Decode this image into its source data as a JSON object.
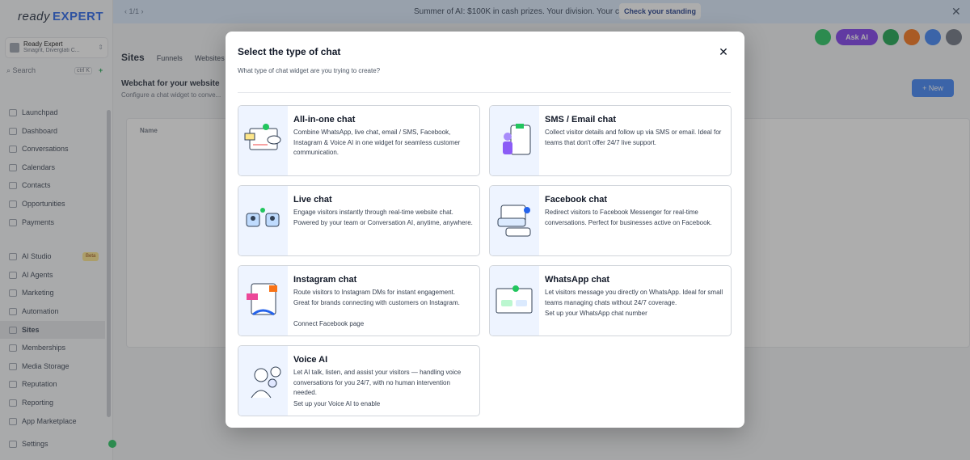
{
  "app": {
    "logo_ready": "ready",
    "logo_expert": "EXPERT",
    "account_name": "Ready Expert",
    "account_sub": "Sinagrit, Diverglati C...",
    "search_label": "Search",
    "search_shortcut": "ctrl K"
  },
  "sidebar": {
    "items": [
      {
        "label": "Launchpad",
        "icon": "rocket-icon"
      },
      {
        "label": "Dashboard",
        "icon": "dashboard-icon"
      },
      {
        "label": "Conversations",
        "icon": "chat-icon"
      },
      {
        "label": "Calendars",
        "icon": "calendar-icon"
      },
      {
        "label": "Contacts",
        "icon": "contacts-icon"
      },
      {
        "label": "Opportunities",
        "icon": "funnel-icon"
      },
      {
        "label": "Payments",
        "icon": "payments-icon"
      }
    ],
    "items2": [
      {
        "label": "AI Studio",
        "icon": "ai-studio-icon",
        "badge": "Beta"
      },
      {
        "label": "AI Agents",
        "icon": "ai-agents-icon"
      },
      {
        "label": "Marketing",
        "icon": "send-icon"
      },
      {
        "label": "Automation",
        "icon": "automation-icon"
      },
      {
        "label": "Sites",
        "icon": "sites-icon",
        "active": true
      },
      {
        "label": "Memberships",
        "icon": "memberships-icon"
      },
      {
        "label": "Media Storage",
        "icon": "media-icon"
      },
      {
        "label": "Reputation",
        "icon": "star-icon"
      },
      {
        "label": "Reporting",
        "icon": "reporting-icon"
      },
      {
        "label": "App Marketplace",
        "icon": "marketplace-icon"
      }
    ],
    "settings_label": "Settings"
  },
  "banner": {
    "pager": "1/1",
    "message": "Summer of AI: $100K in cash prizes. Your division. Your clients.",
    "cta": "Check your standing"
  },
  "header": {
    "ask_ai": "Ask AI",
    "colors": {
      "phone": "#22c55e",
      "ask_ai": "#7c3aed",
      "announce": "#16a34a",
      "bell": "#f97316",
      "help": "#3b82f6",
      "avatar": "#6b7280"
    }
  },
  "subnav": {
    "title": "Sites",
    "tabs": [
      "Funnels",
      "Websites"
    ]
  },
  "page": {
    "title": "Webchat for your website",
    "subtitle": "Configure a chat widget to conve...",
    "new_button": "+ New",
    "column_name": "Name"
  },
  "modal": {
    "title": "Select the type of chat",
    "subtitle": "What type of chat widget are you trying to create?",
    "close_icon": "close-icon",
    "options": [
      {
        "title": "All-in-one chat",
        "description": "Combine WhatsApp, live chat, email / SMS, Facebook, Instagram & Voice AI in one widget for seamless customer communication.",
        "note": ""
      },
      {
        "title": "SMS / Email chat",
        "description": "Collect visitor details and follow up via SMS or email. Ideal for teams that don't offer 24/7 live support.",
        "note": ""
      },
      {
        "title": "Live chat",
        "description": "Engage visitors instantly through real-time website chat. Powered by your team or Conversation AI, anytime, anywhere.",
        "note": ""
      },
      {
        "title": "Facebook chat",
        "description": "Redirect visitors to Facebook Messenger for real-time conversations. Perfect for businesses active on Facebook.",
        "note": ""
      },
      {
        "title": "Instagram chat",
        "description": "Route visitors to Instagram DMs for instant engagement. Great for brands connecting with customers on Instagram.",
        "note": "Connect Facebook page"
      },
      {
        "title": "WhatsApp chat",
        "description": "Let visitors message you directly on WhatsApp. Ideal for small teams managing chats without 24/7 coverage.",
        "note": "Set up your WhatsApp chat number"
      },
      {
        "title": "Voice AI",
        "description": "Let AI talk, listen, and assist your visitors — handling voice conversations for you 24/7, with no human intervention needed.",
        "note": "Set up your Voice AI to enable"
      }
    ]
  }
}
